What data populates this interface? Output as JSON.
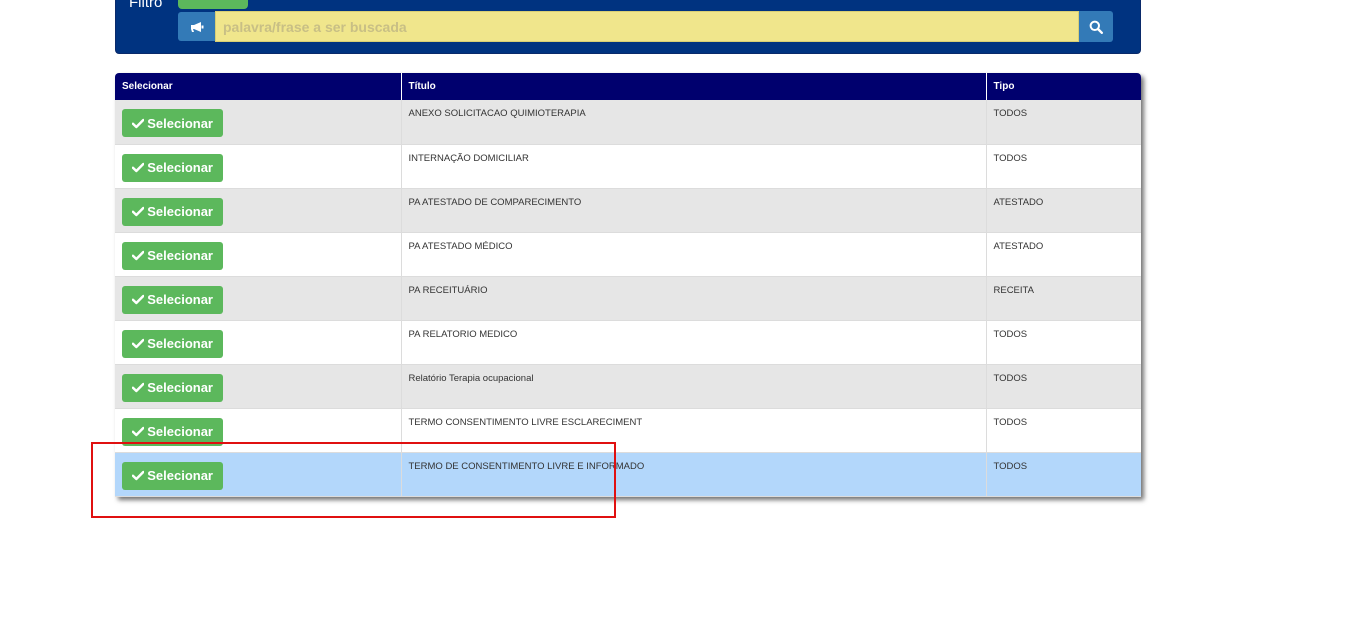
{
  "filter": {
    "label": "Filtro",
    "search_placeholder": "palavra/frase a ser buscada",
    "search_value": "",
    "type_icon": "bullhorn-icon",
    "search_icon": "search-icon"
  },
  "table": {
    "headers": [
      "Selecionar",
      "Título",
      "Tipo"
    ],
    "select_label": "Selecionar",
    "rows": [
      {
        "titulo": "ANEXO SOLICITACAO QUIMIOTERAPIA",
        "tipo": "TODOS"
      },
      {
        "titulo": "INTERNAÇÃO DOMICILIAR",
        "tipo": "TODOS"
      },
      {
        "titulo": "PA ATESTADO DE COMPARECIMENTO",
        "tipo": "ATESTADO"
      },
      {
        "titulo": "PA ATESTADO MÉDICO",
        "tipo": "ATESTADO"
      },
      {
        "titulo": "PA RECEITUÁRIO",
        "tipo": "RECEITA"
      },
      {
        "titulo": "PA RELATORIO MEDICO",
        "tipo": "TODOS"
      },
      {
        "titulo": "Relatório Terapia ocupacional",
        "tipo": "TODOS"
      },
      {
        "titulo": "TERMO CONSENTIMENTO LIVRE ESCLARECIMENT",
        "tipo": "TODOS"
      },
      {
        "titulo": "TERMO DE CONSENTIMENTO LIVRE E INFORMADO",
        "tipo": "TODOS"
      }
    ],
    "highlighted_row_index": 8
  },
  "colors": {
    "panel_bg": "#003380",
    "header_bg": "#00006e",
    "button_green": "#5cb85c",
    "search_bg": "#f0e68c",
    "highlight_row": "#b3d7fb",
    "annotation_red": "#e01010"
  }
}
